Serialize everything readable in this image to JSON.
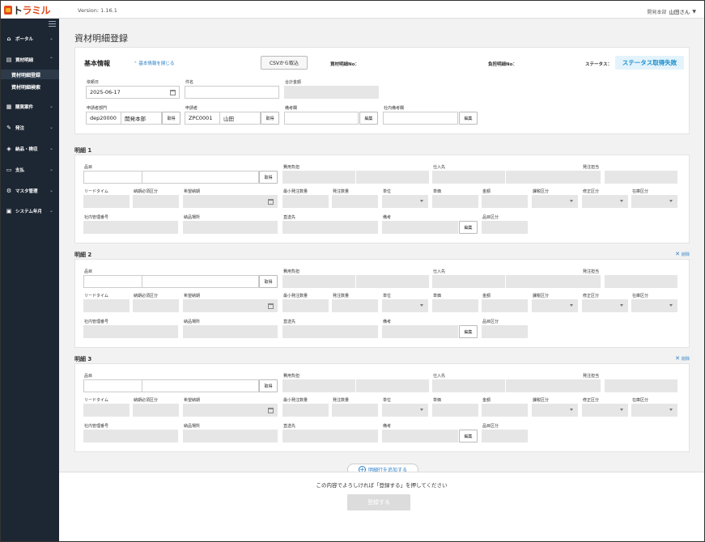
{
  "header": {
    "logo_prefix": "ト",
    "logo_suffix": "ラミル",
    "version": "Version: 1.16.1",
    "department": "開発本部",
    "user": "山田さん"
  },
  "sidebar": {
    "items": [
      {
        "label": "ポータル",
        "icon": "home-icon"
      },
      {
        "label": "資材明細",
        "icon": "clipboard-icon"
      },
      {
        "label": "購買案件",
        "icon": "calculator-icon"
      },
      {
        "label": "発注",
        "icon": "document-edit-icon"
      },
      {
        "label": "納品・検収",
        "icon": "box-icon"
      },
      {
        "label": "支払",
        "icon": "card-icon"
      },
      {
        "label": "マスタ管理",
        "icon": "gear-icon"
      },
      {
        "label": "システム年月",
        "icon": "calendar-icon"
      }
    ],
    "subitems": [
      "資材明細登録",
      "資材明細検索"
    ]
  },
  "page": {
    "title": "資材明細登録"
  },
  "basic": {
    "title": "基本情報",
    "close_link": "基本情報を閉じる",
    "csv_button": "CSVから取込",
    "material_no_label": "資材明細No：",
    "burden_no_label": "負担明細No：",
    "status_label": "ステータス：",
    "status_value": "ステータス取得失敗",
    "request_date_label": "依頼日",
    "request_date": "2025-06-17",
    "subject_label": "件名",
    "total_label": "合計金額",
    "dept_label": "申請者部門",
    "dept_code": "dep20000",
    "dept_name": "開発本部",
    "applicant_label": "申請者",
    "applicant_code": "ZPC0001",
    "applicant_name": "山田",
    "remarks_label": "備考欄",
    "internal_remarks_label": "社内備考欄",
    "fetch_button": "取得",
    "edit_button": "編集"
  },
  "line_labels": {
    "item": "品目",
    "cost_burden": "費用負担",
    "supplier": "仕入先",
    "orderer": "発注担当",
    "lead_time": "リードタイム",
    "delivery_required": "納期必須区分",
    "desired_date": "希望納期",
    "min_qty": "最小発注数量",
    "order_qty": "発注数量",
    "unit": "単位",
    "unit_price": "単価",
    "amount": "金額",
    "tax_class": "課税区分",
    "correction_class": "修正区分",
    "stock_class": "在庫区分",
    "internal_no": "社内管理番号",
    "delivery_place": "納品場所",
    "ship_to": "直送先",
    "remarks": "備考",
    "item_class": "品目区分",
    "fetch_button": "取得",
    "edit_button": "編集",
    "delete_link": "削除"
  },
  "lines": [
    {
      "title": "明細 1"
    },
    {
      "title": "明細 2"
    },
    {
      "title": "明細 3"
    }
  ],
  "add_row_button": "明細行を追加する",
  "footer": {
    "confirm_text": "この内容でよろしければ「登録する」を押してください",
    "register_button": "登録する"
  },
  "colors": {
    "sidebar": "#1d2733",
    "accent": "#2a7fc9",
    "status_bg": "#e4f3fb",
    "logo": "#e04a1a"
  }
}
